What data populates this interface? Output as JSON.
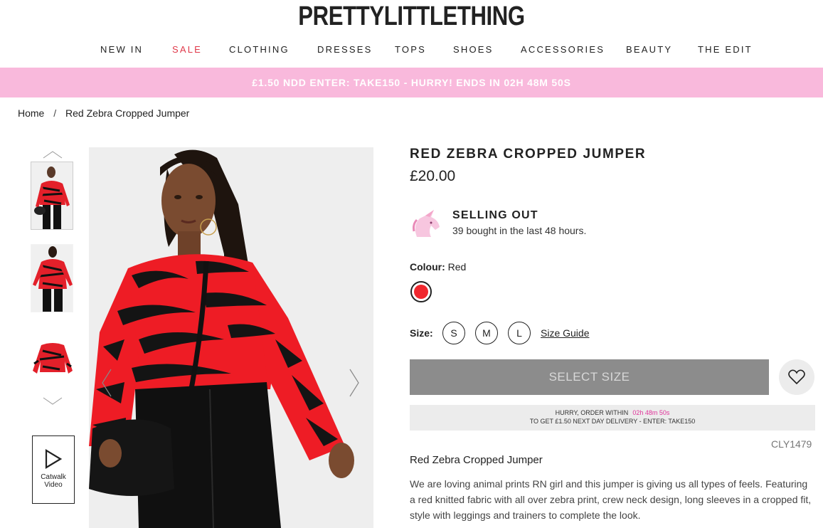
{
  "brand": {
    "logo": "PRETTYLITTLETHING"
  },
  "nav": {
    "items": [
      {
        "label": "NEW IN"
      },
      {
        "label": "SALE"
      },
      {
        "label": "CLOTHING"
      },
      {
        "label": "DRESSES"
      },
      {
        "label": "TOPS"
      },
      {
        "label": "SHOES"
      },
      {
        "label": "ACCESSORIES"
      },
      {
        "label": "BEAUTY"
      },
      {
        "label": "THE EDIT"
      }
    ]
  },
  "promo": {
    "text": "£1.50 NDD ENTER: TAKE150 - HURRY! ENDS IN 02H 48M 50S"
  },
  "breadcrumb": {
    "home": "Home",
    "separator": "/",
    "current": "Red Zebra Cropped Jumper"
  },
  "gallery": {
    "catwalk_line1": "Catwalk",
    "catwalk_line2": "Video"
  },
  "product": {
    "title": "RED ZEBRA CROPPED JUMPER",
    "price": "£20.00",
    "selling_out_title": "SELLING OUT",
    "selling_out_sub": "39 bought in the last 48 hours.",
    "colour_label": "Colour:",
    "colour_value": "Red",
    "colour_hex": "#f0272e",
    "size_label": "Size:",
    "sizes": [
      "S",
      "M",
      "L"
    ],
    "size_guide": "Size Guide",
    "select_size": "SELECT SIZE",
    "hurry_line1": "HURRY, ORDER WITHIN",
    "hurry_timer": "02h 48m 50s",
    "hurry_line2": "TO GET £1.50 NEXT DAY DELIVERY - ENTER: TAKE150",
    "sku": "CLY1479",
    "desc_title": "Red Zebra Cropped Jumper",
    "description": "We are loving animal prints RN girl and this jumper is giving us all types of feels. Featuring a red knitted fabric with all over zebra print, crew neck design, long sleeves in a cropped fit, style with leggings and trainers to complete the look."
  },
  "colors": {
    "promo_bg": "#f9b9dc",
    "sale": "#e0394a",
    "timer": "#e0349a",
    "button_bg": "#8c8c8c"
  },
  "icons": [
    "chevron-up-icon",
    "chevron-down-icon",
    "play-icon",
    "arrow-left-icon",
    "arrow-right-icon",
    "unicorn-icon",
    "heart-icon"
  ]
}
